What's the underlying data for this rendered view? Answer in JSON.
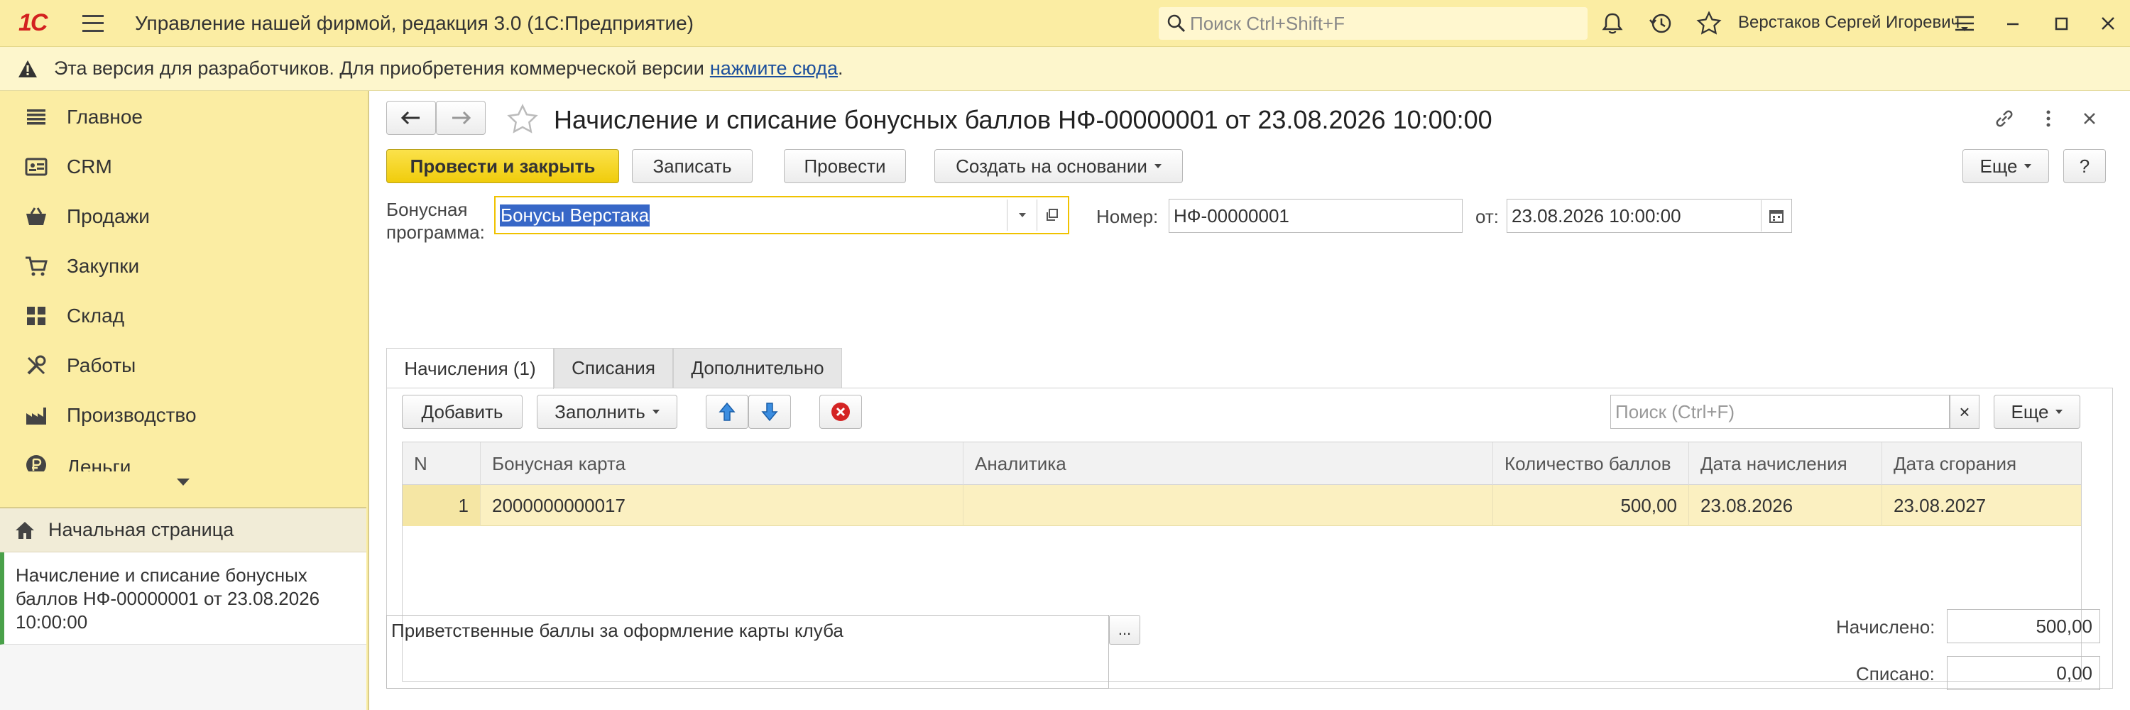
{
  "app": {
    "title": "Управление нашей фирмой, редакция 3.0  (1С:Предприятие)",
    "logo": "1С",
    "search_placeholder": "Поиск Ctrl+Shift+F",
    "user": "Верстаков Сергей Игоревич"
  },
  "banner": {
    "text": "Эта версия для разработчиков. Для приобретения коммерческой версии",
    "link": "нажмите сюда",
    "after": "."
  },
  "sidebar": {
    "items": [
      {
        "label": "Главное",
        "icon": "list-icon"
      },
      {
        "label": "CRM",
        "icon": "crm-icon"
      },
      {
        "label": "Продажи",
        "icon": "basket-icon"
      },
      {
        "label": "Закупки",
        "icon": "cart-icon"
      },
      {
        "label": "Склад",
        "icon": "warehouse-icon"
      },
      {
        "label": "Работы",
        "icon": "tools-icon"
      },
      {
        "label": "Производство",
        "icon": "factory-icon"
      },
      {
        "label": "Деньги",
        "icon": "ruble-icon"
      }
    ],
    "home": "Начальная страница",
    "open_doc": "Начисление и списание бонусных баллов НФ-00000001 от 23.08.2026 10:00:00"
  },
  "form": {
    "title": "Начисление и списание бонусных баллов НФ-00000001 от 23.08.2026 10:00:00",
    "buttons": {
      "post_close": "Провести и закрыть",
      "save": "Записать",
      "post": "Провести",
      "create_based": "Создать на основании",
      "more": "Еще",
      "help": "?"
    },
    "program_label_1": "Бонусная",
    "program_label_2": "программа:",
    "program_value": "Бонусы Верстака",
    "number_label": "Номер:",
    "number_value": "НФ-00000001",
    "date_label": "от:",
    "date_value": "23.08.2026 10:00:00",
    "tabs": [
      "Начисления (1)",
      "Списания",
      "Дополнительно"
    ],
    "table_toolbar": {
      "add": "Добавить",
      "fill": "Заполнить",
      "search_placeholder": "Поиск (Ctrl+F)",
      "clear": "×",
      "more": "Еще"
    },
    "columns": [
      "N",
      "Бонусная карта",
      "Аналитика",
      "Количество баллов",
      "Дата начисления",
      "Дата сгорания"
    ],
    "rows": [
      {
        "n": "1",
        "card": "2000000000017",
        "analytics": "",
        "points": "500,00",
        "accrual_date": "23.08.2026",
        "expiry_date": "23.08.2027"
      }
    ],
    "comment": "Приветственные баллы за оформление карты клуба",
    "comment_btn": "...",
    "accrued_label": "Начислено:",
    "accrued_value": "500,00",
    "written_off_label": "Списано:",
    "written_off_value": "0,00"
  },
  "colors": {
    "titlebar": "#fbeda3",
    "primary_button": "#f0cc0b",
    "selected_row": "#fbf0c1",
    "link": "#1c4f9c",
    "logo": "#d3211f"
  }
}
